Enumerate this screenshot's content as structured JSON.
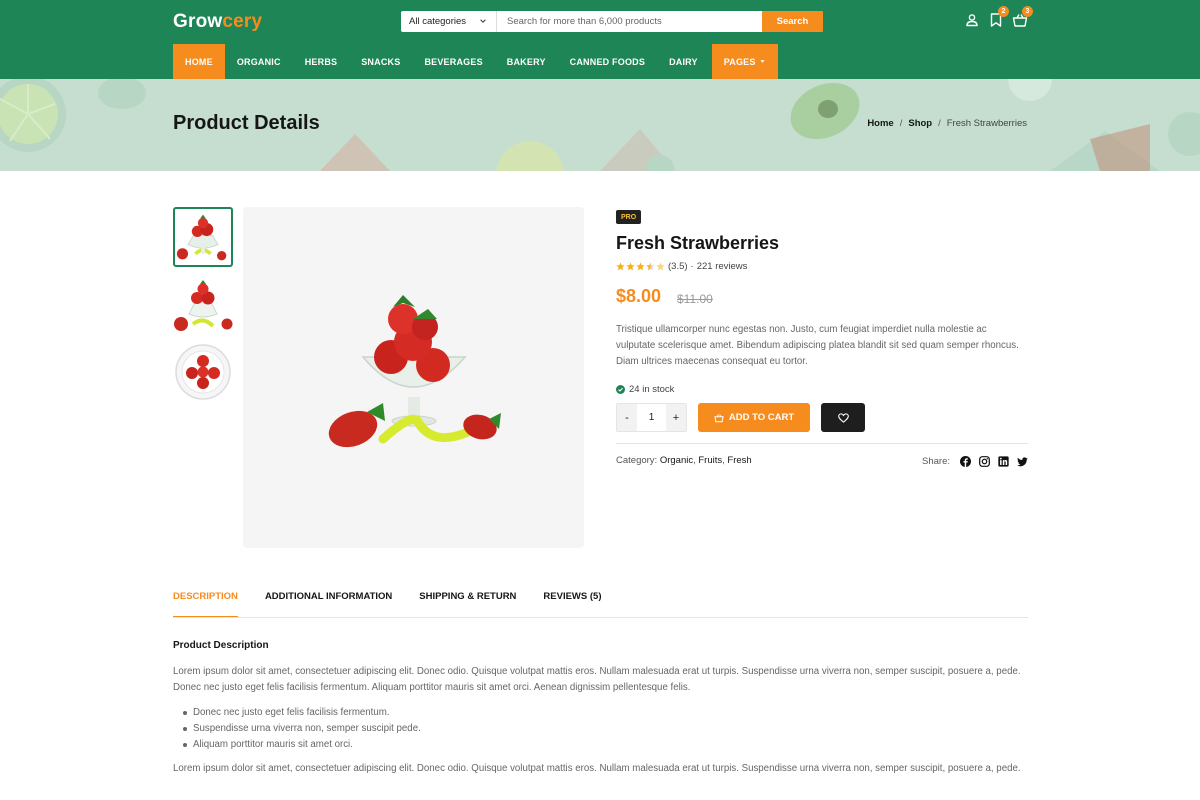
{
  "brand": {
    "part1": "Grow",
    "part2": "cery"
  },
  "search": {
    "category": "All categories",
    "placeholder": "Search for more than 6,000 products",
    "button": "Search"
  },
  "header_icons": {
    "account": "user-icon",
    "wishlist": {
      "icon": "bookmark-icon",
      "count": "2"
    },
    "cart": {
      "icon": "basket-icon",
      "count": "3"
    }
  },
  "nav": {
    "items": [
      "HOME",
      "ORGANIC",
      "HERBS",
      "SNACKS",
      "BEVERAGES",
      "BAKERY",
      "CANNED FOODS",
      "DAIRY",
      "PAGES"
    ]
  },
  "banner": {
    "title": "Product Details",
    "breadcrumb": [
      "Home",
      "Shop",
      "Fresh Strawberries"
    ],
    "separator": "/"
  },
  "product": {
    "badge": "PRO",
    "title": "Fresh Strawberries",
    "rating_text": "(3.5)",
    "rating_value": 3.5,
    "reviews": "221 reviews",
    "price": "$8.00",
    "old_price": "$11.00",
    "description": "Tristique ullamcorper nunc egestas non. Justo, cum feugiat imperdiet nulla molestie ac vulputate scelerisque amet. Bibendum adipiscing platea blandit sit sed quam semper rhoncus. Diam ultrices maecenas consequat eu tortor.",
    "stock": "24 in stock",
    "quantity": "1",
    "minus": "-",
    "plus": "+",
    "add_to_cart": "ADD TO CART",
    "category_label": "Category:",
    "categories": [
      "Organic",
      "Fruits",
      "Fresh"
    ],
    "share_label": "Share:",
    "share_icons": [
      "facebook-icon",
      "instagram-icon",
      "linkedin-icon",
      "twitter-icon"
    ]
  },
  "tabs": [
    "DESCRIPTION",
    "ADDITIONAL INFORMATION",
    "SHIPPING & RETURN",
    "REVIEWS (5)"
  ],
  "description_section": {
    "heading": "Product Description",
    "para1": "Lorem ipsum dolor sit amet, consectetuer adipiscing elit. Donec odio. Quisque volutpat mattis eros. Nullam malesuada erat ut turpis. Suspendisse urna viverra non, semper suscipit, posuere a, pede. Donec nec justo eget felis facilisis fermentum. Aliquam porttitor mauris sit amet orci. Aenean dignissim pellentesque felis.",
    "bullets": [
      "Donec nec justo eget felis facilisis fermentum.",
      "Suspendisse urna viverra non, semper suscipit pede.",
      "Aliquam porttitor mauris sit amet orci."
    ],
    "para2": "Lorem ipsum dolor sit amet, consectetuer adipiscing elit. Donec odio. Quisque volutpat mattis eros. Nullam malesuada erat ut turpis. Suspendisse urna viverra non, semper suscipit, posuere a, pede."
  },
  "colors": {
    "brand_green": "#1d8556",
    "accent_orange": "#f68b1e",
    "banner_bg": "#c5ded0",
    "dark": "#1e1e1e"
  }
}
